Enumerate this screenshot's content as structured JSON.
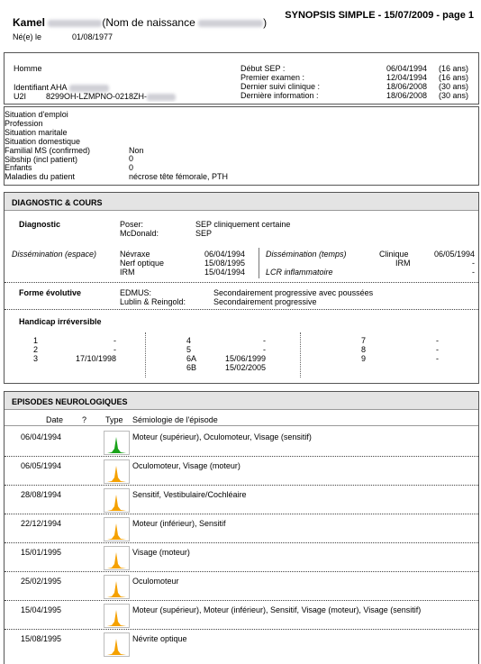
{
  "header": {
    "patient_first_name": "Kamel",
    "birth_name_label": "(Nom de naissance",
    "birth_name_close": ")",
    "born_label": "Né(e) le",
    "birth_date": "01/08/1977",
    "report_title": "SYNOPSIS SIMPLE - 15/07/2009 - page 1"
  },
  "identity": {
    "sex": "Homme",
    "identifier_label": "Identifiant AHA",
    "u2i_label": "U2I",
    "u2i_value": "8299OH-LZMPNO-0218ZH-",
    "dates": [
      {
        "label": "Début SEP :",
        "date": "06/04/1994",
        "age": "(16 ans)"
      },
      {
        "label": "Premier examen :",
        "date": "12/04/1994",
        "age": "(16 ans)"
      },
      {
        "label": "Dernier suivi clinique :",
        "date": "18/06/2008",
        "age": "(30 ans)"
      },
      {
        "label": "Dernière information :",
        "date": "18/06/2008",
        "age": "(30 ans)"
      }
    ]
  },
  "social": [
    {
      "label": "Situation d'emploi",
      "value": ""
    },
    {
      "label": "Profession",
      "value": ""
    },
    {
      "label": "Situation maritale",
      "value": ""
    },
    {
      "label": "Situation domestique",
      "value": ""
    },
    {
      "label": "Familial MS (confirmed)",
      "value": "Non"
    },
    {
      "label": "Sibship (incl patient)",
      "value": "0"
    },
    {
      "label": "Enfants",
      "value": "0"
    },
    {
      "label": "Maladies du patient",
      "value": "nécrose tête fémorale, PTH"
    }
  ],
  "diagnostic": {
    "section_title": "DIAGNOSTIC & COURS",
    "diagnostic_label": "Diagnostic",
    "poser_label": "Poser:",
    "poser_value": "SEP cliniquement certaine",
    "mcdonald_label": "McDonald:",
    "mcdonald_value": "SEP",
    "dissem_space_label": "Dissémination (espace)",
    "dissem_space": [
      {
        "label": "Névraxe",
        "date": "06/04/1994"
      },
      {
        "label": "Nerf optique",
        "date": "15/08/1995"
      },
      {
        "label": "IRM",
        "date": "15/04/1994"
      }
    ],
    "dissem_time_label": "Dissémination (temps)",
    "dissem_time": [
      {
        "label": "Clinique",
        "date": "06/05/1994"
      },
      {
        "label": "IRM",
        "date": "-"
      }
    ],
    "lcr_label": "LCR inflammatoire",
    "lcr_value": "-",
    "forme_label": "Forme évolutive",
    "edmus_label": "EDMUS:",
    "edmus_value": "Secondairement progressive avec poussées",
    "lublin_label": "Lublin & Reingold:",
    "lublin_value": "Secondairement progressive",
    "handicap_label": "Handicap irréversible",
    "handicap_col1": [
      {
        "n": "1",
        "d": "-"
      },
      {
        "n": "2",
        "d": "-"
      },
      {
        "n": "3",
        "d": "17/10/1998"
      }
    ],
    "handicap_col2": [
      {
        "n": "4",
        "d": "-"
      },
      {
        "n": "5",
        "d": "-"
      },
      {
        "n": "6A",
        "d": "15/06/1999"
      },
      {
        "n": "6B",
        "d": "15/02/2005"
      }
    ],
    "handicap_col3": [
      {
        "n": "7",
        "d": "-"
      },
      {
        "n": "8",
        "d": "-"
      },
      {
        "n": "9",
        "d": "-"
      }
    ]
  },
  "episodes": {
    "section_title": "EPISODES NEUROLOGIQUES",
    "col_date": "Date",
    "col_q": "?",
    "col_type": "Type",
    "col_semio": "Sémiologie de l'épisode",
    "colors": {
      "first": "#1aa31a",
      "relapse": "#f5a100"
    },
    "rows": [
      {
        "date": "06/04/1994",
        "semio": "Moteur (supérieur), Oculomoteur, Visage (sensitif)",
        "kind": "first"
      },
      {
        "date": "06/05/1994",
        "semio": "Oculomoteur, Visage (moteur)",
        "kind": "relapse"
      },
      {
        "date": "28/08/1994",
        "semio": "Sensitif, Vestibulaire/Cochléaire",
        "kind": "relapse"
      },
      {
        "date": "22/12/1994",
        "semio": "Moteur (inférieur), Sensitif",
        "kind": "relapse"
      },
      {
        "date": "15/01/1995",
        "semio": "Visage (moteur)",
        "kind": "relapse"
      },
      {
        "date": "25/02/1995",
        "semio": "Oculomoteur",
        "kind": "relapse"
      },
      {
        "date": "15/04/1995",
        "semio": "Moteur (supérieur), Moteur (inférieur), Sensitif, Visage (moteur), Visage (sensitif)",
        "kind": "relapse"
      },
      {
        "date": "15/08/1995",
        "semio": "Névrite optique",
        "kind": "relapse"
      }
    ]
  }
}
